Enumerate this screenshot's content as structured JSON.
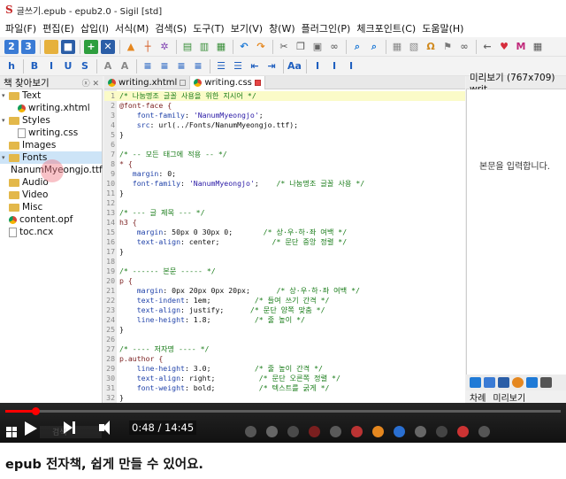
{
  "window": {
    "title": "글쓰기.epub - epub2.0 - Sigil [std]"
  },
  "menubar": [
    "파일(F)",
    "편집(E)",
    "삽입(I)",
    "서식(M)",
    "검색(S)",
    "도구(T)",
    "보기(V)",
    "창(W)",
    "플러그인(P)",
    "체크포인트(C)",
    "도움말(H)"
  ],
  "toolbar_row1": {
    "icons": [
      {
        "name": "heading-2-icon",
        "glyph": "2",
        "bg": "#3a7bd5",
        "fg": "#fff"
      },
      {
        "name": "heading-3-icon",
        "glyph": "3",
        "bg": "#3a7bd5",
        "fg": "#fff"
      },
      {
        "name": "open-folder-icon",
        "glyph": "▬",
        "bg": "#e6b13d",
        "fg": "#e6b13d"
      },
      {
        "name": "save-icon",
        "glyph": "■",
        "bg": "#2b5ea7",
        "fg": "#fff"
      },
      {
        "name": "add-icon",
        "glyph": "+",
        "bg": "#2e9e3e",
        "fg": "#fff"
      },
      {
        "name": "close-x-icon",
        "glyph": "✕",
        "bg": "#2b5ea7",
        "fg": "#fff"
      },
      {
        "name": "arrow-up-icon",
        "glyph": "▲",
        "bg": "transparent",
        "fg": "#e5871f"
      },
      {
        "name": "split-icon",
        "glyph": "┼",
        "bg": "transparent",
        "fg": "#d65a20"
      },
      {
        "name": "settings-icon",
        "glyph": "✲",
        "bg": "transparent",
        "fg": "#7d3fb0"
      },
      {
        "name": "metadata-icon",
        "glyph": "▤",
        "bg": "transparent",
        "fg": "#3a8f3a"
      },
      {
        "name": "toc-icon",
        "glyph": "▥",
        "bg": "transparent",
        "fg": "#3a8f3a"
      },
      {
        "name": "index-icon",
        "glyph": "▦",
        "bg": "transparent",
        "fg": "#3a8f3a"
      },
      {
        "name": "undo-icon",
        "glyph": "↶",
        "bg": "transparent",
        "fg": "#1f7ad6"
      },
      {
        "name": "redo-icon",
        "glyph": "↷",
        "bg": "transparent",
        "fg": "#e5871f"
      },
      {
        "name": "cut-icon",
        "glyph": "✂",
        "bg": "transparent",
        "fg": "#555"
      },
      {
        "name": "copy-icon",
        "glyph": "❐",
        "bg": "transparent",
        "fg": "#555"
      },
      {
        "name": "paste-icon",
        "glyph": "▣",
        "bg": "transparent",
        "fg": "#666"
      },
      {
        "name": "link-icon",
        "glyph": "∞",
        "bg": "transparent",
        "fg": "#777"
      },
      {
        "name": "search-icon",
        "glyph": "⌕",
        "bg": "transparent",
        "fg": "#1f7ad6"
      },
      {
        "name": "zoom-icon",
        "glyph": "⌕",
        "bg": "transparent",
        "fg": "#1f7ad6"
      },
      {
        "name": "table-icon",
        "glyph": "▦",
        "bg": "transparent",
        "fg": "#888"
      },
      {
        "name": "image-icon",
        "glyph": "▧",
        "bg": "transparent",
        "fg": "#888"
      },
      {
        "name": "special-char-icon",
        "glyph": "Ω",
        "bg": "transparent",
        "fg": "#d08a1f"
      },
      {
        "name": "tag-icon",
        "glyph": "⚑",
        "bg": "transparent",
        "fg": "#777"
      },
      {
        "name": "chain-icon",
        "glyph": "∞",
        "bg": "transparent",
        "fg": "#777"
      },
      {
        "name": "back-icon",
        "glyph": "←",
        "bg": "transparent",
        "fg": "#666"
      },
      {
        "name": "heart-icon",
        "glyph": "♥",
        "bg": "transparent",
        "fg": "#d62d3c"
      },
      {
        "name": "m-icon",
        "glyph": "M",
        "bg": "transparent",
        "fg": "#c0287a"
      },
      {
        "name": "grid-icon",
        "glyph": "▦",
        "bg": "transparent",
        "fg": "#555"
      }
    ]
  },
  "toolbar_row2": {
    "icons": [
      {
        "name": "heading-h-icon",
        "glyph": "h",
        "bg": "transparent",
        "fg": "#1f5fbf"
      },
      {
        "name": "bold-icon",
        "glyph": "B",
        "bg": "transparent",
        "fg": "#1f5fbf"
      },
      {
        "name": "italic-icon",
        "glyph": "I",
        "bg": "transparent",
        "fg": "#1f5fbf"
      },
      {
        "name": "underline-icon",
        "glyph": "U",
        "bg": "transparent",
        "fg": "#1f5fbf"
      },
      {
        "name": "strike-icon",
        "glyph": "S",
        "bg": "transparent",
        "fg": "#1f5fbf"
      },
      {
        "name": "subscript-icon",
        "glyph": "A",
        "bg": "transparent",
        "fg": "#888"
      },
      {
        "name": "superscript-icon",
        "glyph": "A",
        "bg": "transparent",
        "fg": "#888"
      },
      {
        "name": "align-left-icon",
        "glyph": "≡",
        "bg": "transparent",
        "fg": "#1f5fbf"
      },
      {
        "name": "align-center-icon",
        "glyph": "≡",
        "bg": "transparent",
        "fg": "#1f5fbf"
      },
      {
        "name": "align-right-icon",
        "glyph": "≡",
        "bg": "transparent",
        "fg": "#1f5fbf"
      },
      {
        "name": "align-justify-icon",
        "glyph": "≡",
        "bg": "transparent",
        "fg": "#1f5fbf"
      },
      {
        "name": "bullet-list-icon",
        "glyph": "☰",
        "bg": "transparent",
        "fg": "#1f5fbf"
      },
      {
        "name": "number-list-icon",
        "glyph": "☰",
        "bg": "transparent",
        "fg": "#1f5fbf"
      },
      {
        "name": "outdent-icon",
        "glyph": "⇤",
        "bg": "transparent",
        "fg": "#1f5fbf"
      },
      {
        "name": "indent-icon",
        "glyph": "⇥",
        "bg": "transparent",
        "fg": "#1f5fbf"
      },
      {
        "name": "case-icon",
        "glyph": "Aa",
        "bg": "transparent",
        "fg": "#1f5fbf"
      },
      {
        "name": "insert-id-icon",
        "glyph": "I",
        "bg": "transparent",
        "fg": "#1f5fbf"
      },
      {
        "name": "insert-class-icon",
        "glyph": "I",
        "bg": "transparent",
        "fg": "#1f5fbf"
      },
      {
        "name": "insert-style-icon",
        "glyph": "I",
        "bg": "transparent",
        "fg": "#1f5fbf"
      }
    ]
  },
  "book_browser": {
    "title": "책 찾아보기",
    "items": [
      {
        "label": "Text",
        "type": "folder",
        "level": 0,
        "arrow": "▾"
      },
      {
        "label": "writing.xhtml",
        "type": "xhtml",
        "level": 1
      },
      {
        "label": "Styles",
        "type": "folder",
        "level": 0,
        "arrow": "▾"
      },
      {
        "label": "writing.css",
        "type": "file",
        "level": 1
      },
      {
        "label": "Images",
        "type": "folder",
        "level": 0,
        "arrow": ""
      },
      {
        "label": "Fonts",
        "type": "folder",
        "level": 0,
        "arrow": "▾",
        "selected": true
      },
      {
        "label": "NanumMyeongjo.ttf",
        "type": "font",
        "level": 1
      },
      {
        "label": "Audio",
        "type": "folder",
        "level": 0,
        "arrow": ""
      },
      {
        "label": "Video",
        "type": "folder",
        "level": 0,
        "arrow": ""
      },
      {
        "label": "Misc",
        "type": "folder",
        "level": 0,
        "arrow": ""
      },
      {
        "label": "content.opf",
        "type": "xhtml",
        "level": 0
      },
      {
        "label": "toc.ncx",
        "type": "file",
        "level": 0
      }
    ]
  },
  "editor": {
    "tabs": [
      {
        "label": "writing.xhtml",
        "active": false
      },
      {
        "label": "writing.css",
        "active": true
      }
    ],
    "lines": [
      [
        {
          "t": "/* 나눔명조 글꼴 사용을 위한 지시어 */",
          "c": "comment"
        }
      ],
      [
        {
          "t": "@font-face {",
          "c": "selector"
        }
      ],
      [
        {
          "t": "    font-family",
          "c": "prop"
        },
        {
          "t": ": ",
          "c": ""
        },
        {
          "t": "'NanumMyeongjo'",
          "c": "str"
        },
        {
          "t": ";",
          "c": ""
        }
      ],
      [
        {
          "t": "    src",
          "c": "prop"
        },
        {
          "t": ": url(../Fonts/NanumMyeongjo.ttf);",
          "c": ""
        }
      ],
      [
        {
          "t": "}",
          "c": ""
        }
      ],
      [],
      [
        {
          "t": "/* -- 모든 태그에 적용 -- */",
          "c": "comment"
        }
      ],
      [
        {
          "t": "* {",
          "c": "selector"
        }
      ],
      [
        {
          "t": "   margin",
          "c": "prop"
        },
        {
          "t": ": 0;",
          "c": ""
        }
      ],
      [
        {
          "t": "   font-family",
          "c": "prop"
        },
        {
          "t": ": ",
          "c": ""
        },
        {
          "t": "'NanumMyeongjo'",
          "c": "str"
        },
        {
          "t": ";    ",
          "c": ""
        },
        {
          "t": "/* 나눔명조 글꼴 사용 */",
          "c": "comment"
        }
      ],
      [
        {
          "t": "}",
          "c": ""
        }
      ],
      [],
      [
        {
          "t": "/* --- 글 제목 --- */",
          "c": "comment"
        }
      ],
      [
        {
          "t": "h3 {",
          "c": "selector"
        }
      ],
      [
        {
          "t": "    margin",
          "c": "prop"
        },
        {
          "t": ": 50px 0 30px 0;       ",
          "c": ""
        },
        {
          "t": "/* 상·우·하·좌 여백 */",
          "c": "comment"
        }
      ],
      [
        {
          "t": "    text-align",
          "c": "prop"
        },
        {
          "t": ": center;            ",
          "c": ""
        },
        {
          "t": "/* 문단 중앙 정렬 */",
          "c": "comment"
        }
      ],
      [
        {
          "t": "}",
          "c": ""
        }
      ],
      [],
      [
        {
          "t": "/* ------ 본문 ----- */",
          "c": "comment"
        }
      ],
      [
        {
          "t": "p {",
          "c": "selector"
        }
      ],
      [
        {
          "t": "    margin",
          "c": "prop"
        },
        {
          "t": ": 0px 20px 0px 20px;      ",
          "c": ""
        },
        {
          "t": "/* 상·우·하·좌 여백 */",
          "c": "comment"
        }
      ],
      [
        {
          "t": "    text-indent",
          "c": "prop"
        },
        {
          "t": ": 1em;          ",
          "c": ""
        },
        {
          "t": "/* 들여 쓰기 간격 */",
          "c": "comment"
        }
      ],
      [
        {
          "t": "    text-align",
          "c": "prop"
        },
        {
          "t": ": justify;      ",
          "c": ""
        },
        {
          "t": "/* 문단 양쪽 맞춤 */",
          "c": "comment"
        }
      ],
      [
        {
          "t": "    line-height",
          "c": "prop"
        },
        {
          "t": ": 1.8;          ",
          "c": ""
        },
        {
          "t": "/* 줄 높이 */",
          "c": "comment"
        }
      ],
      [
        {
          "t": "}",
          "c": ""
        }
      ],
      [],
      [
        {
          "t": "/* ---- 저자명 ---- */",
          "c": "comment"
        }
      ],
      [
        {
          "t": "p.author {",
          "c": "selector"
        }
      ],
      [
        {
          "t": "    line-height",
          "c": "prop"
        },
        {
          "t": ": 3.0;          ",
          "c": ""
        },
        {
          "t": "/* 줄 높이 간격 */",
          "c": "comment"
        }
      ],
      [
        {
          "t": "    text-align",
          "c": "prop"
        },
        {
          "t": ": right;          ",
          "c": ""
        },
        {
          "t": "/* 문단 오른쪽 정렬 */",
          "c": "comment"
        }
      ],
      [
        {
          "t": "    font-weight",
          "c": "prop"
        },
        {
          "t": ": bold;          ",
          "c": ""
        },
        {
          "t": "/* 텍스트를 굵게 */",
          "c": "comment"
        }
      ],
      [
        {
          "t": "}",
          "c": ""
        }
      ]
    ],
    "highlighted_line": 1
  },
  "preview": {
    "title": "미리보기 (767x709) writ",
    "placeholder": "본문을 입력합니다.",
    "tabs": [
      "차례",
      "미리보기"
    ]
  },
  "video": {
    "time": "0:48 / 14:45",
    "progress": 0.054,
    "search_placeholder": "검색"
  },
  "caption": "epub 전자책, 쉽게 만들 수 있어요.",
  "colors": {
    "accent_red": "#ff0000",
    "comment_green": "#1b7d1b"
  }
}
